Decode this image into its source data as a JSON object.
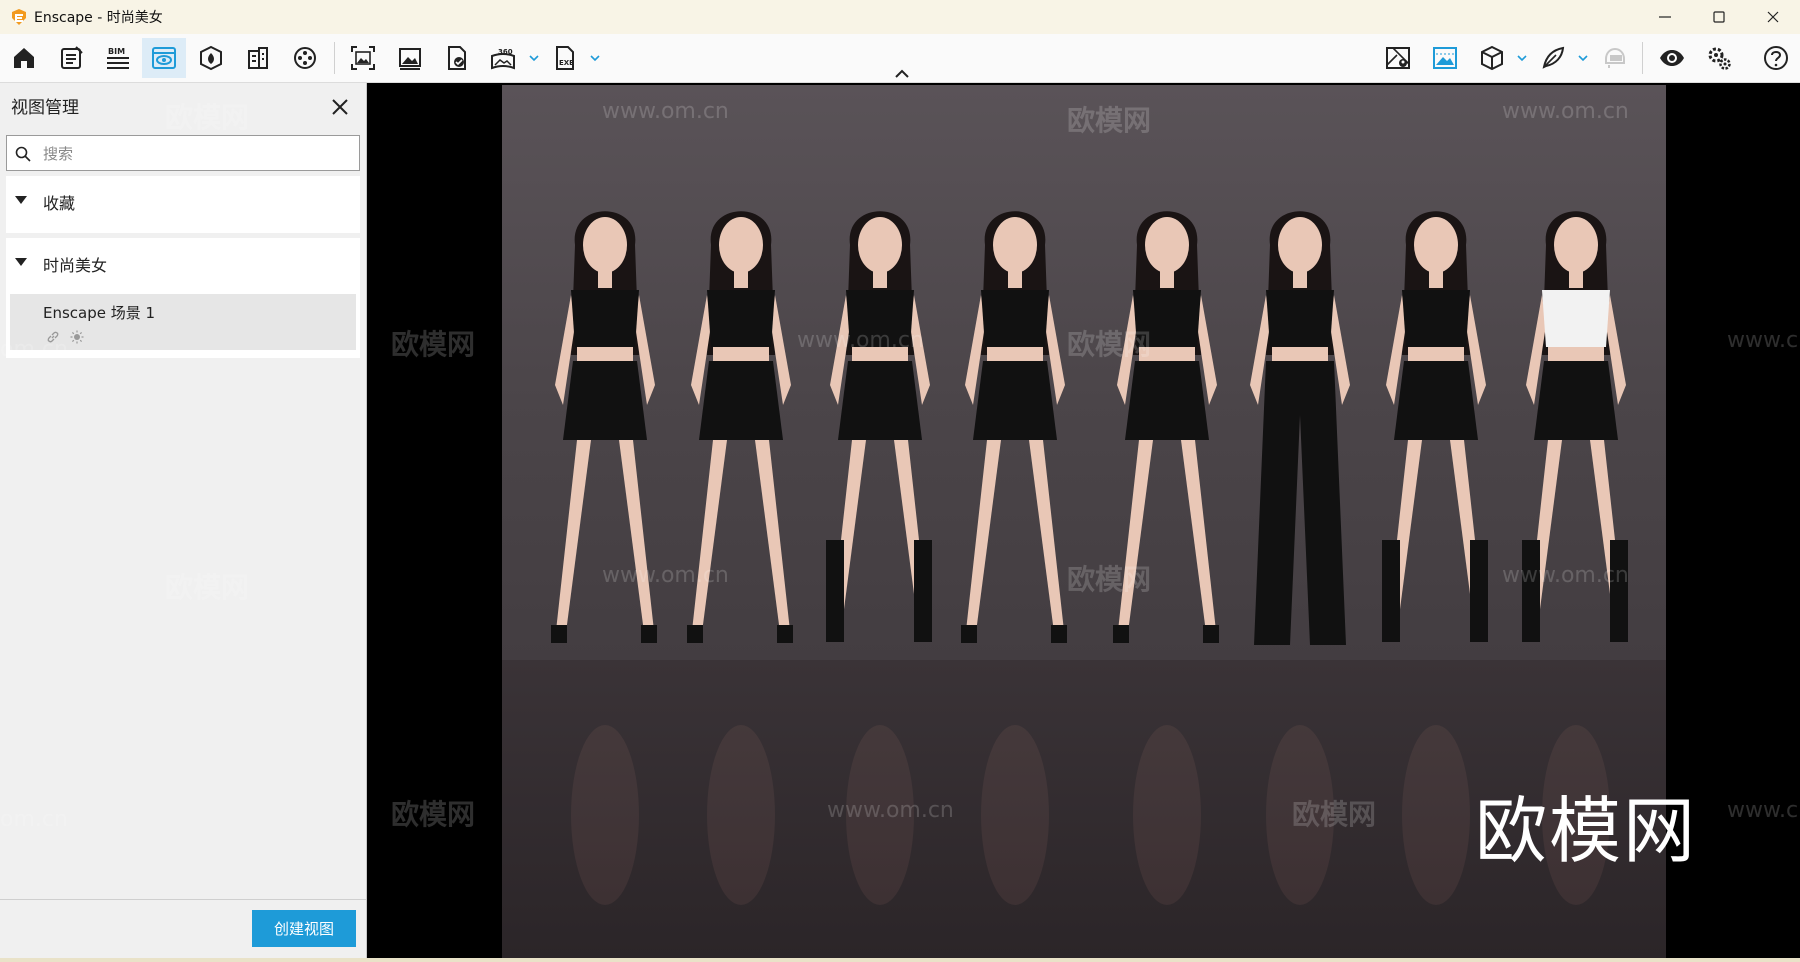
{
  "window": {
    "app_icon": "enscape-logo-icon",
    "title": "Enscape - 时尚美女",
    "controls": [
      "minimize-icon",
      "maximize-icon",
      "close-icon"
    ]
  },
  "toolbar": {
    "left_icons": [
      "home-icon",
      "document-icon",
      "bim-icon",
      "view-management-icon",
      "material-icon",
      "building-icon",
      "film-reel-icon",
      "screenshot-icon",
      "image-icon",
      "export-file-icon",
      "panorama-360-icon",
      "exe-export-icon"
    ],
    "bim_label": "BIM",
    "pano_label": "360",
    "exe_label": "EXE",
    "right_icons": [
      "map-icon",
      "render-mode-icon",
      "cube-icon",
      "feather-icon",
      "vr-headset-icon",
      "eye-icon",
      "settings-gears-icon",
      "help-icon"
    ],
    "accent": "#1e9bd8"
  },
  "sidebar": {
    "title": "视图管理",
    "search": {
      "placeholder": "搜索",
      "value": ""
    },
    "sections": [
      {
        "label": "收藏",
        "expanded": true,
        "items": []
      },
      {
        "label": "时尚美女",
        "expanded": true,
        "items": [
          {
            "name": "Enscape 场景 1",
            "icons": [
              "link-icon",
              "sun-icon"
            ]
          }
        ]
      }
    ],
    "create_button": "创建视图"
  },
  "viewport": {
    "watermarks": [
      "欧模网",
      "www.om.cn",
      "om.cn",
      "www.c"
    ],
    "logo_text": "欧模网"
  }
}
